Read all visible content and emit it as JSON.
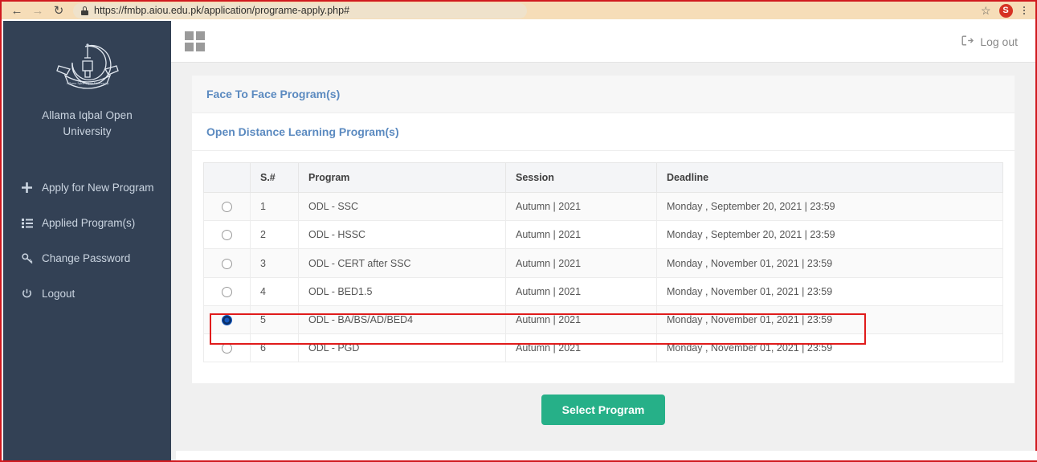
{
  "browser": {
    "back_icon": "arrow-left-icon",
    "forward_icon": "arrow-right-icon",
    "reload_icon": "reload-icon",
    "lock_icon": "lock-icon",
    "url": "https://fmbp.aiou.edu.pk/application/programe-apply.php#",
    "bookmark_icon": "star-icon",
    "profile_initial": "S",
    "menu_icon": "kebab-menu-icon"
  },
  "sidebar": {
    "logo_icon": "university-crest-icon",
    "brand_line1": "Allama Iqbal Open",
    "brand_line2": "University",
    "items": [
      {
        "label": "Apply for New Program",
        "icon": "plus-icon"
      },
      {
        "label": "Applied Program(s)",
        "icon": "list-icon"
      },
      {
        "label": "Change Password",
        "icon": "key-icon"
      },
      {
        "label": "Logout",
        "icon": "power-icon"
      }
    ]
  },
  "topbar": {
    "grid_icon": "grid-toggle-icon",
    "logout_icon": "sign-out-icon",
    "logout_label": "Log out"
  },
  "accordions": [
    {
      "label": "Face To Face Program(s)",
      "expanded": false
    },
    {
      "label": "Open Distance Learning Program(s)",
      "expanded": true
    }
  ],
  "table": {
    "columns": [
      "",
      "S.#",
      "Program",
      "Session",
      "Deadline"
    ],
    "rows": [
      {
        "selected": false,
        "sn": "1",
        "program": "ODL - SSC",
        "session": "Autumn | 2021",
        "deadline": "Monday , September 20, 2021 | 23:59"
      },
      {
        "selected": false,
        "sn": "2",
        "program": "ODL - HSSC",
        "session": "Autumn | 2021",
        "deadline": "Monday , September 20, 2021 | 23:59"
      },
      {
        "selected": false,
        "sn": "3",
        "program": "ODL - CERT after SSC",
        "session": "Autumn | 2021",
        "deadline": "Monday , November 01, 2021 | 23:59"
      },
      {
        "selected": false,
        "sn": "4",
        "program": "ODL - BED1.5",
        "session": "Autumn | 2021",
        "deadline": "Monday , November 01, 2021 | 23:59"
      },
      {
        "selected": true,
        "sn": "5",
        "program": "ODL - BA/BS/AD/BED4",
        "session": "Autumn | 2021",
        "deadline": "Monday , November 01, 2021 | 23:59"
      },
      {
        "selected": false,
        "sn": "6",
        "program": "ODL - PGD",
        "session": "Autumn | 2021",
        "deadline": "Monday , November 01, 2021 | 23:59"
      }
    ]
  },
  "actions": {
    "select_program_label": "Select Program"
  },
  "colors": {
    "sidebar_bg": "#334155",
    "link_blue": "#5b8ac0",
    "button_green": "#26b088",
    "highlight_red": "#e01b1b",
    "avatar_red": "#d63224"
  }
}
